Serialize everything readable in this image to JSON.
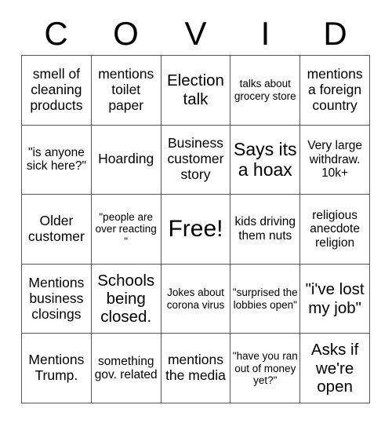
{
  "card": {
    "title_letters": [
      "C",
      "O",
      "V",
      "I",
      "D"
    ],
    "columns": 5,
    "rows": 5,
    "free_space_label": "Free!",
    "colors": {
      "text": "#000000",
      "grid_line": "#555555",
      "background": "#ffffff"
    }
  },
  "cells": [
    {
      "text": "smell of cleaning products",
      "size": "m"
    },
    {
      "text": "mentions toilet paper",
      "size": "m"
    },
    {
      "text": "Election talk",
      "size": "l"
    },
    {
      "text": "talks about grocery store",
      "size": "xs"
    },
    {
      "text": "mentions a foreign country",
      "size": "m"
    },
    {
      "text": "\"is anyone sick here?\"",
      "size": "s"
    },
    {
      "text": "Hoarding",
      "size": "m"
    },
    {
      "text": "Business customer story",
      "size": "m"
    },
    {
      "text": "Says its a hoax",
      "size": "xl"
    },
    {
      "text": "Very large withdraw. 10k+",
      "size": "s"
    },
    {
      "text": "Older customer",
      "size": "m"
    },
    {
      "text": "\"people are over reacting \"",
      "size": "xs"
    },
    {
      "text": "Free!",
      "size": "free"
    },
    {
      "text": "kids driving them nuts",
      "size": "s"
    },
    {
      "text": "religious anecdote religion",
      "size": "s"
    },
    {
      "text": "Mentions business closings",
      "size": "m"
    },
    {
      "text": "Schools being closed.",
      "size": "l"
    },
    {
      "text": "Jokes about corona virus",
      "size": "xs"
    },
    {
      "text": "\"surprised the lobbies open\"",
      "size": "xs"
    },
    {
      "text": "\"i've lost my job\"",
      "size": "l"
    },
    {
      "text": "Mentions Trump.",
      "size": "m"
    },
    {
      "text": "something gov. related",
      "size": "s"
    },
    {
      "text": "mentions the media",
      "size": "m"
    },
    {
      "text": "\"have you ran out of money yet?\"",
      "size": "xs"
    },
    {
      "text": "Asks if we're open",
      "size": "l"
    }
  ]
}
